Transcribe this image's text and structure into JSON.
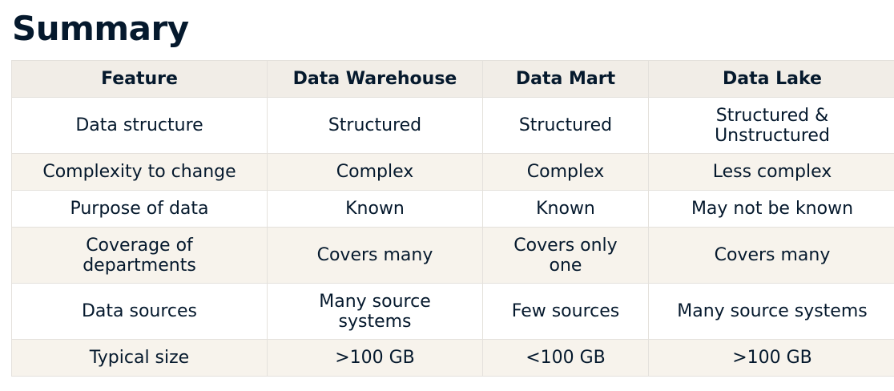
{
  "title": "Summary",
  "table": {
    "headers": [
      "Feature",
      "Data Warehouse",
      "Data Mart",
      "Data Lake"
    ],
    "rows": [
      [
        "Data structure",
        "Structured",
        "Structured",
        "Structured & Unstructured"
      ],
      [
        "Complexity to change",
        "Complex",
        "Complex",
        "Less complex"
      ],
      [
        "Purpose of data",
        "Known",
        "Known",
        "May not be known"
      ],
      [
        "Coverage of departments",
        "Covers many",
        "Covers only one",
        "Covers many"
      ],
      [
        "Data sources",
        "Many source systems",
        "Few sources",
        "Many source systems"
      ],
      [
        "Typical size",
        ">100 GB",
        "<100 GB",
        ">100 GB"
      ]
    ]
  }
}
